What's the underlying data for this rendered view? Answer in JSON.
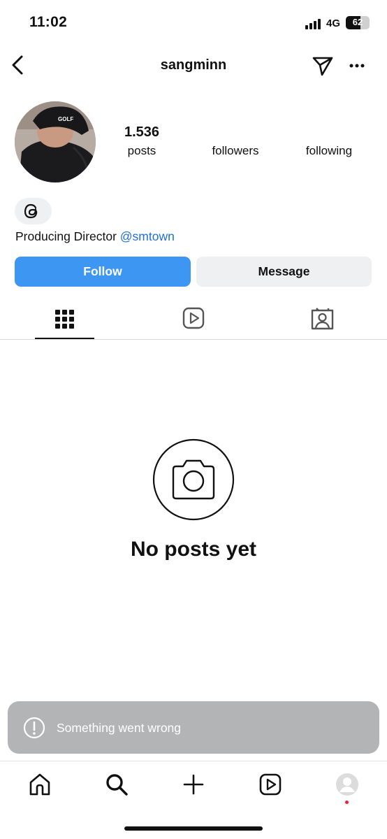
{
  "status_bar": {
    "time": "11:02",
    "network": "4G",
    "battery_level": 62,
    "battery_text": "62",
    "icons": [
      "signal-icon",
      "battery-icon"
    ]
  },
  "header": {
    "username": "sangminn",
    "icons": [
      "back-arrow-icon",
      "send-icon",
      "more-icon"
    ]
  },
  "profile": {
    "avatar_icon": "avatar-photo",
    "stats": {
      "posts_count": "1.536",
      "posts_label": "posts",
      "followers_label": "followers",
      "following_label": "following"
    },
    "threads_icon": "threads-icon",
    "bio_text": "Producing Director ",
    "bio_link": "@smtown",
    "link_color": "#1f6fd6"
  },
  "actions": {
    "follow_label": "Follow",
    "message_label": "Message",
    "follow_color": "#3d96f2"
  },
  "tabs": {
    "items": [
      "grid-icon",
      "reels-icon",
      "tagged-icon"
    ],
    "selected": "grid-icon"
  },
  "empty_state": {
    "icon": "camera-icon",
    "title": "No posts yet"
  },
  "toast": {
    "icon": "alert-icon",
    "message": "Something went wrong"
  },
  "bottom_nav": {
    "items": [
      "home-icon",
      "search-icon",
      "create-icon",
      "reels-icon",
      "profile-avatar"
    ],
    "notification_dot_color": "#ee2330"
  }
}
